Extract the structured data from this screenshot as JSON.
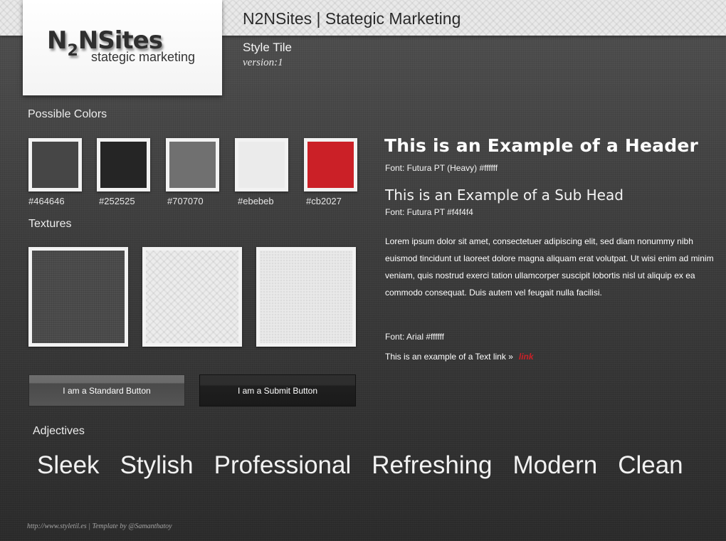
{
  "header": {
    "site_title": "N2NSites | Stategic Marketing",
    "tile_title": "Style Tile",
    "version": "version:1"
  },
  "logo": {
    "part1": "N",
    "part2": "2",
    "part3": "NSites",
    "tagline": "stategic marketing"
  },
  "colors": {
    "label": "Possible Colors",
    "swatches": [
      {
        "hex": "#464646",
        "label": "#464646"
      },
      {
        "hex": "#252525",
        "label": "#252525"
      },
      {
        "hex": "#707070",
        "label": "#707070"
      },
      {
        "hex": "#ebebeb",
        "label": "#ebebeb"
      },
      {
        "hex": "#cb2027",
        "label": "#cb2027"
      }
    ]
  },
  "textures": {
    "label": "Textures",
    "items": [
      "dark-linen",
      "light-crosshatch",
      "light-paper"
    ]
  },
  "buttons": {
    "standard_label": "I am a Standard Button",
    "submit_label": "I am a Submit Button"
  },
  "typography": {
    "header_example": "This is an Example of a Header",
    "header_font": "Font: Futura PT (Heavy)  #ffffff",
    "subhead_example": "This is an Example of a Sub Head",
    "subhead_font": "Font: Futura PT #f4f4f4",
    "body_text": "Lorem ipsum dolor sit amet, consectetuer adipiscing elit, sed diam nonummy nibh euismod tincidunt ut laoreet dolore magna aliquam erat volutpat. Ut wisi enim ad minim veniam, quis nostrud exerci tation ullamcorper suscipit lobortis nisl ut aliquip ex ea commodo consequat. Duis autem vel feugait nulla facilisi.",
    "body_font": "Font: Arial #ffffff",
    "link_prefix": "This is an example of a Text link »",
    "link_text": "link",
    "link_color": "#cb2027"
  },
  "adjectives": {
    "label": "Adjectives",
    "items": [
      "Sleek",
      "Stylish",
      "Professional",
      "Refreshing",
      "Modern",
      "Clean"
    ]
  },
  "footer": {
    "credit": "http://www.styletil.es | Template by @Samanthatoy"
  }
}
